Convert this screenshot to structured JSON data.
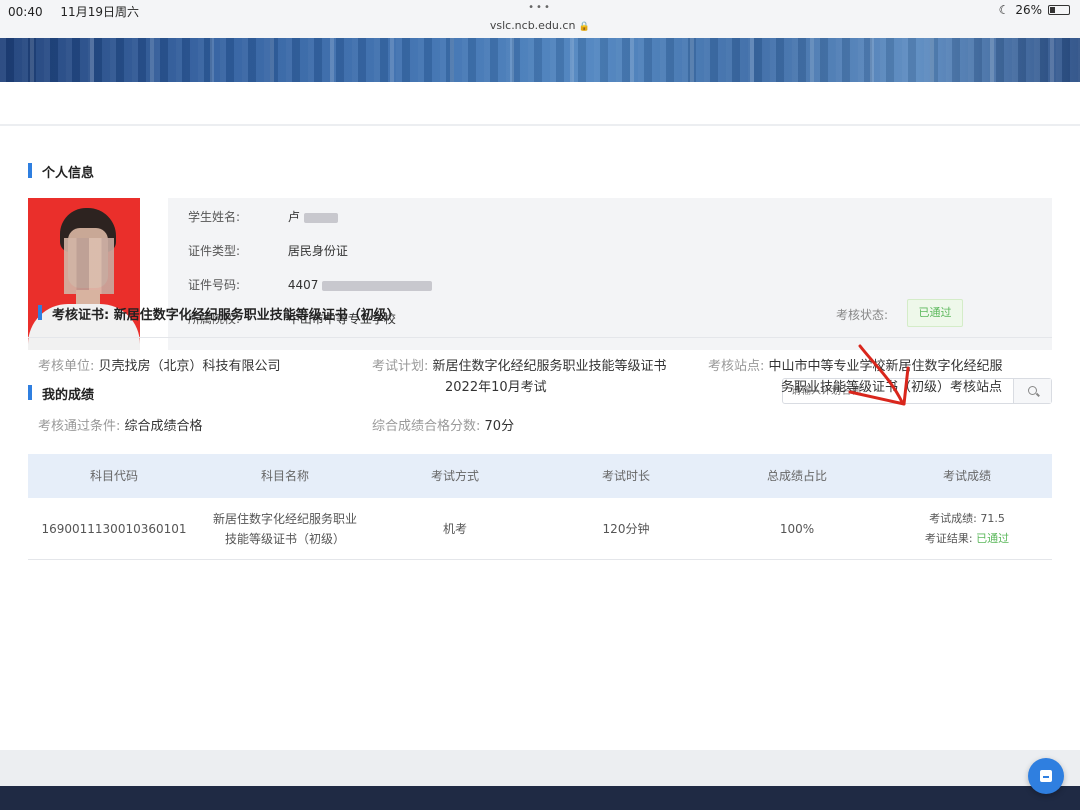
{
  "statusbar": {
    "time": "00:40",
    "date": "11月19日周六",
    "url": "vslc.ncb.edu.cn",
    "battery": "26%"
  },
  "personal": {
    "title": "个人信息",
    "name_label": "学生姓名:",
    "name_value": "卢",
    "id_type_label": "证件类型:",
    "id_type_value": "居民身份证",
    "id_no_label": "证件号码:",
    "id_no_value": "4407",
    "school_label": "所属院校:",
    "school_value": "中山市中等专业学校"
  },
  "scores": {
    "title": "我的成绩",
    "search_placeholder": "请输入计划名称"
  },
  "cert": {
    "title": "考核证书:  新居住数字化经纪服务职业技能等级证书（初级）",
    "status_label": "考核状态:",
    "status_value": "已通过",
    "unit_label": "考核单位:",
    "unit_value": "贝壳找房（北京）科技有限公司",
    "plan_label": "考试计划:",
    "plan_value_1": "新居住数字化经纪服务职业技能等级证书",
    "plan_value_2": "2022年10月考试",
    "site_label": "考核站点:",
    "site_value_1": "中山市中等专业学校新居住数字化经纪服",
    "site_value_2": "务职业技能等级证书（初级）考核站点",
    "cond_label": "考核通过条件:",
    "cond_value": "综合成绩合格",
    "pass_score_label": "综合成绩合格分数:",
    "pass_score_value": "70分"
  },
  "table": {
    "headers": [
      "科目代码",
      "科目名称",
      "考试方式",
      "考试时长",
      "总成绩占比",
      "考试成绩"
    ],
    "row": {
      "code": "1690011130010360101",
      "name_1": "新居住数字化经纪服务职业",
      "name_2": "技能等级证书（初级）",
      "mode": "机考",
      "duration": "120分钟",
      "weight": "100%",
      "score_label": "考试成绩:",
      "score_value": "71.5",
      "result_label": "考证结果:",
      "result_value": "已通过"
    }
  },
  "colors": {
    "accent": "#2f7fe0",
    "pass": "#5cb85c",
    "annotation": "#d9261c"
  }
}
